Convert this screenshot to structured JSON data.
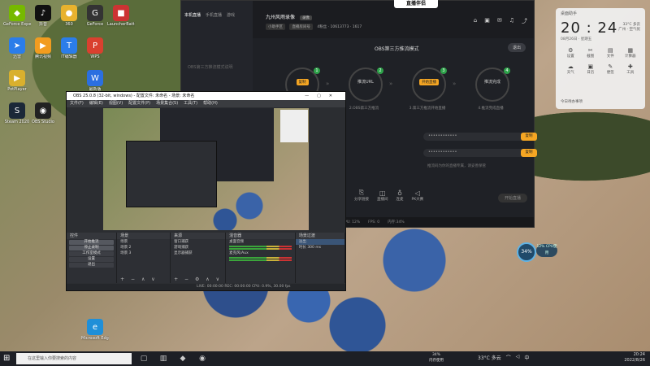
{
  "desktop": {
    "icons": [
      {
        "label": "GeForce Experience",
        "glyph": "◆",
        "color": "#76b900"
      },
      {
        "label": "抖音",
        "glyph": "♪",
        "color": "#111"
      },
      {
        "label": "360",
        "glyph": "●",
        "color": "#e8b22e"
      },
      {
        "label": "GeForce",
        "glyph": "G",
        "color": "#333"
      },
      {
        "label": "LauncherBattle",
        "glyph": "■",
        "color": "#c33"
      },
      {
        "label": "迅雷",
        "glyph": "➤",
        "color": "#2b7de9"
      },
      {
        "label": "腾讯视频",
        "glyph": "▶",
        "color": "#f29c1f"
      },
      {
        "label": "IT编辑器",
        "glyph": "T",
        "color": "#2b7de9"
      },
      {
        "label": "WPS",
        "glyph": "P",
        "color": "#d9402f"
      },
      {
        "label": "PotPlayer",
        "glyph": "▶",
        "color": "#d9b02e"
      },
      {
        "label": "Steam 2020",
        "glyph": "S",
        "color": "#1b2838"
      },
      {
        "label": "OBS Studio",
        "glyph": "◉",
        "color": "#222"
      },
      {
        "label": "最新版",
        "glyph": "W",
        "color": "#2b6fe0"
      },
      {
        "label": "Microsoft Edge",
        "glyph": "e",
        "color": "#1f8fd8"
      }
    ]
  },
  "stream_app": {
    "logo": "直播伴侣",
    "tabs": [
      "本机直播",
      "手机直播",
      "游戏"
    ],
    "left_hint": "OBS第三方推流模式说明",
    "title": "九州风雨录像",
    "tag": "录像",
    "sub_chips": [
      "小助手区",
      "直播房间号"
    ],
    "stats": "4粉丝 · 10613773 · 1617",
    "mode_title": "OBS第三方推流模式",
    "quit": "退出",
    "steps": [
      {
        "num": "1",
        "inner": "复制",
        "desc": "1.OBS设置推流地址"
      },
      {
        "num": "2",
        "inner": "推流URL",
        "desc": "2.OBS第三方推流"
      },
      {
        "num": "3",
        "inner": "开始直播",
        "desc": "3.第三方推流开始直播"
      },
      {
        "num": "4",
        "inner": "推流完成",
        "desc": "4.推流完成直播"
      }
    ],
    "field1": "••••••••••••",
    "field2": "••••••••••••",
    "copy": "复制",
    "note": "推流码为你的直播专属，请妥善保管",
    "tools": [
      "分享链接",
      "直播间",
      "连麦",
      "PK大赛"
    ],
    "live_btn": "开始直播",
    "status": [
      "CPU: 12%",
      "FPS: 0",
      "内存:34%"
    ]
  },
  "widget": {
    "head": "桌面助手",
    "time": "20 : 24",
    "date": "08月26日 · 星期五",
    "weather": "33°C 多云\n广州 · 空气优",
    "items": [
      "设置",
      "截图",
      "文件",
      "计算器",
      "天气",
      "日历",
      "便签",
      "工具"
    ],
    "line": "今日待办事项",
    "search": "搜索应用文件"
  },
  "cpu": {
    "percent": "34%",
    "label": "12% CPU使用"
  },
  "obs": {
    "title": "OBS 25.0.8 (32-bit, windows) - 配置文件: 未命名 - 场景: 未命名",
    "menu": [
      "文件(F)",
      "编辑(E)",
      "视图(V)",
      "配置文件(P)",
      "场景集合(S)",
      "工具(T)",
      "帮助(H)"
    ],
    "docks": {
      "controls": {
        "title": "控件",
        "buttons": [
          "开始推流",
          "停止录制",
          "工作室模式",
          "设置",
          "退出"
        ]
      },
      "scenes": {
        "title": "场景",
        "rows": [
          "场景",
          "场景 2",
          "场景 3"
        ]
      },
      "sources": {
        "title": "来源",
        "rows": [
          "窗口捕获",
          "游戏捕获",
          "显示器捕获"
        ]
      },
      "mixer": {
        "title": "混音器",
        "rows": [
          "桌面音频",
          "麦克风/Aux"
        ]
      },
      "transitions": {
        "title": "场景过渡",
        "rows": [
          "淡出",
          "时长 300 ms"
        ]
      }
    },
    "status": "LIVE: 00:00:00   REC: 00:00:00   CPU: 0.9%, 30.00 fps"
  },
  "taskbar": {
    "search_placeholder": "在这里输入你要搜索的内容",
    "memory": "34%\n内存使用",
    "weather": "33°C 多云",
    "lang": "中",
    "time": "20:24",
    "date": "2022/8/26"
  }
}
